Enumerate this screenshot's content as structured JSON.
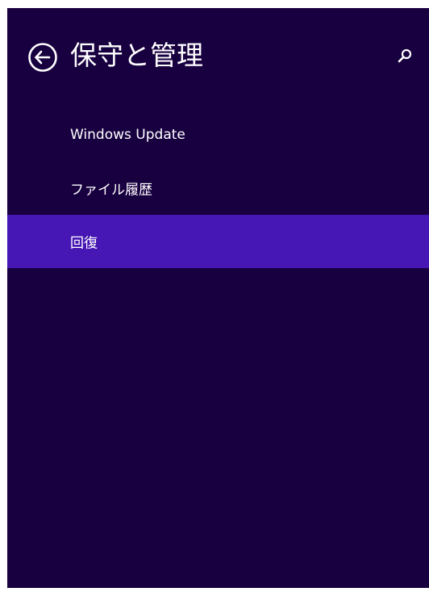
{
  "header": {
    "title": "保守と管理",
    "back_icon": "back-arrow-circle-icon",
    "search_icon": "search-icon"
  },
  "nav": {
    "items": [
      {
        "label": "Windows Update",
        "selected": false
      },
      {
        "label": "ファイル履歴",
        "selected": false
      },
      {
        "label": "回復",
        "selected": true
      }
    ]
  },
  "colors": {
    "background": "#180040",
    "selected": "#4617b4",
    "text": "#ffffff"
  }
}
